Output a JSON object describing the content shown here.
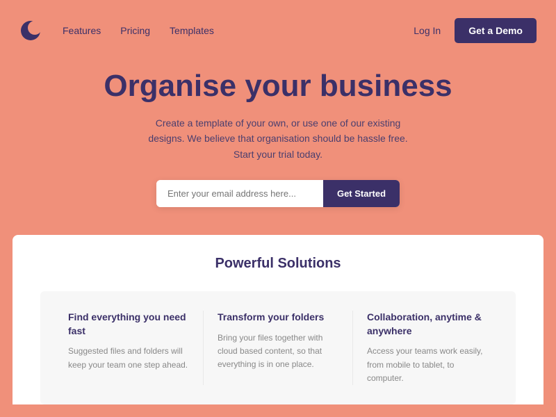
{
  "colors": {
    "brand": "#3b3068",
    "accent": "#f0907a",
    "white": "#ffffff"
  },
  "navbar": {
    "links": [
      {
        "label": "Features",
        "id": "features"
      },
      {
        "label": "Pricing",
        "id": "pricing"
      },
      {
        "label": "Templates",
        "id": "templates"
      }
    ],
    "login_label": "Log In",
    "demo_label": "Get a Demo"
  },
  "hero": {
    "title": "Organise your business",
    "subtitle": "Create a template of your own, or use one of our existing designs. We believe that organisation should be hassle free. Start your trial today.",
    "email_placeholder": "Enter your email address here...",
    "cta_label": "Get Started"
  },
  "solutions": {
    "section_title": "Powerful Solutions",
    "cards": [
      {
        "title": "Find everything you need fast",
        "description": "Suggested files and folders will keep your team one step ahead."
      },
      {
        "title": "Transform your folders",
        "description": "Bring your files together with cloud based content, so that everything is in one place."
      },
      {
        "title": "Collaboration, anytime & anywhere",
        "description": "Access your teams work easily, from mobile to tablet, to computer."
      }
    ]
  }
}
